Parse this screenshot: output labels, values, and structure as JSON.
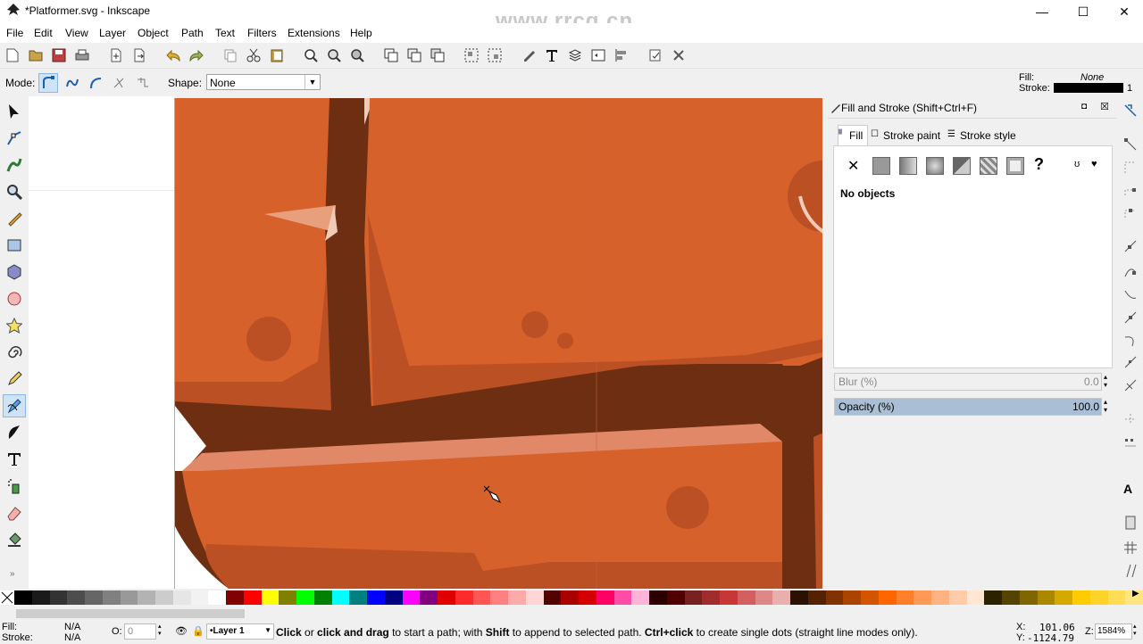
{
  "window": {
    "title": "*Platformer.svg - Inkscape",
    "minimize": "—",
    "maximize": "☐",
    "close": "✕",
    "watermark": "www.rrcg.cn"
  },
  "menu": [
    "File",
    "Edit",
    "View",
    "Layer",
    "Object",
    "Path",
    "Text",
    "Filters",
    "Extensions",
    "Help"
  ],
  "commands": [
    "new-icon",
    "open-icon",
    "save-icon",
    "print-icon",
    "import-icon",
    "export-icon",
    "undo-icon",
    "redo-icon",
    "copy-icon",
    "cut-icon",
    "paste-icon",
    "zoom-selection-icon",
    "zoom-drawing-icon",
    "zoom-page-icon",
    "duplicate-icon",
    "clone-icon",
    "unlink-clone-icon",
    "group-icon",
    "ungroup-icon",
    "xml-editor-icon",
    "text-font-icon",
    "layers-icon",
    "object-properties-icon",
    "align-icon",
    "preferences-icon",
    "document-properties-icon"
  ],
  "style_indicator": {
    "fill_label": "Fill:",
    "fill_value": "None",
    "stroke_label": "Stroke:",
    "stroke_width": "1"
  },
  "tool_controls": {
    "mode_label": "Mode:",
    "shape_label": "Shape:",
    "shape_value": "None"
  },
  "dialog": {
    "title": "Fill and Stroke (Shift+Ctrl+F)",
    "tabs": [
      "Fill",
      "Stroke paint",
      "Stroke style"
    ],
    "unset_symbol": "✕",
    "unknown_symbol": "?",
    "message": "No objects",
    "blur_label": "Blur (%)",
    "blur_value": "0.0",
    "opacity_label": "Opacity (%)",
    "opacity_value": "100.0",
    "opacity_fraction": 1.0
  },
  "palette": [
    "#000000",
    "#1a1a1a",
    "#333333",
    "#4d4d4d",
    "#666666",
    "#808080",
    "#999999",
    "#b3b3b3",
    "#cccccc",
    "#e6e6e6",
    "#f2f2f2",
    "#ffffff",
    "#800000",
    "#ff0000",
    "#ffff00",
    "#808000",
    "#00ff00",
    "#008000",
    "#00ffff",
    "#008080",
    "#0000ff",
    "#000080",
    "#ff00ff",
    "#800080",
    "#e00000",
    "#ff2a2a",
    "#ff5555",
    "#ff8080",
    "#ffaaaa",
    "#ffd5d5",
    "#550000",
    "#aa0000",
    "#d40000",
    "#ff0066",
    "#ff4da6",
    "#ffb3d9",
    "#2b0000",
    "#500000",
    "#782121",
    "#a02c2c",
    "#c83737",
    "#d35f5f",
    "#de8787",
    "#e9afaf",
    "#2b1100",
    "#552200",
    "#803300",
    "#aa4400",
    "#d45500",
    "#ff6600",
    "#ff7f2a",
    "#ff9955",
    "#ffb380",
    "#ffccaa",
    "#ffe6d5",
    "#2b2200",
    "#554400",
    "#806600",
    "#aa8800",
    "#d4aa00",
    "#ffcc00",
    "#ffd42a",
    "#ffdd55",
    "#ffe680"
  ],
  "status": {
    "fill_label": "Fill:",
    "fill_value": "N/A",
    "stroke_label": "Stroke:",
    "stroke_value": "N/A",
    "opacity_label": "O:",
    "opacity_value": "0",
    "layer": "•Layer 1",
    "msg_bold1": "Click",
    "msg_t1": " or ",
    "msg_bold2": "click and drag",
    "msg_t2": " to start a path; with ",
    "msg_bold3": "Shift",
    "msg_t3": " to append to selected path. ",
    "msg_bold4": "Ctrl+click",
    "msg_t4": " to create single dots (straight line modes only).",
    "x_label": "X:",
    "x_value": "101.06",
    "y_label": "Y:",
    "y_value": "-1124.79",
    "z_label": "Z:",
    "zoom": "1584%"
  }
}
